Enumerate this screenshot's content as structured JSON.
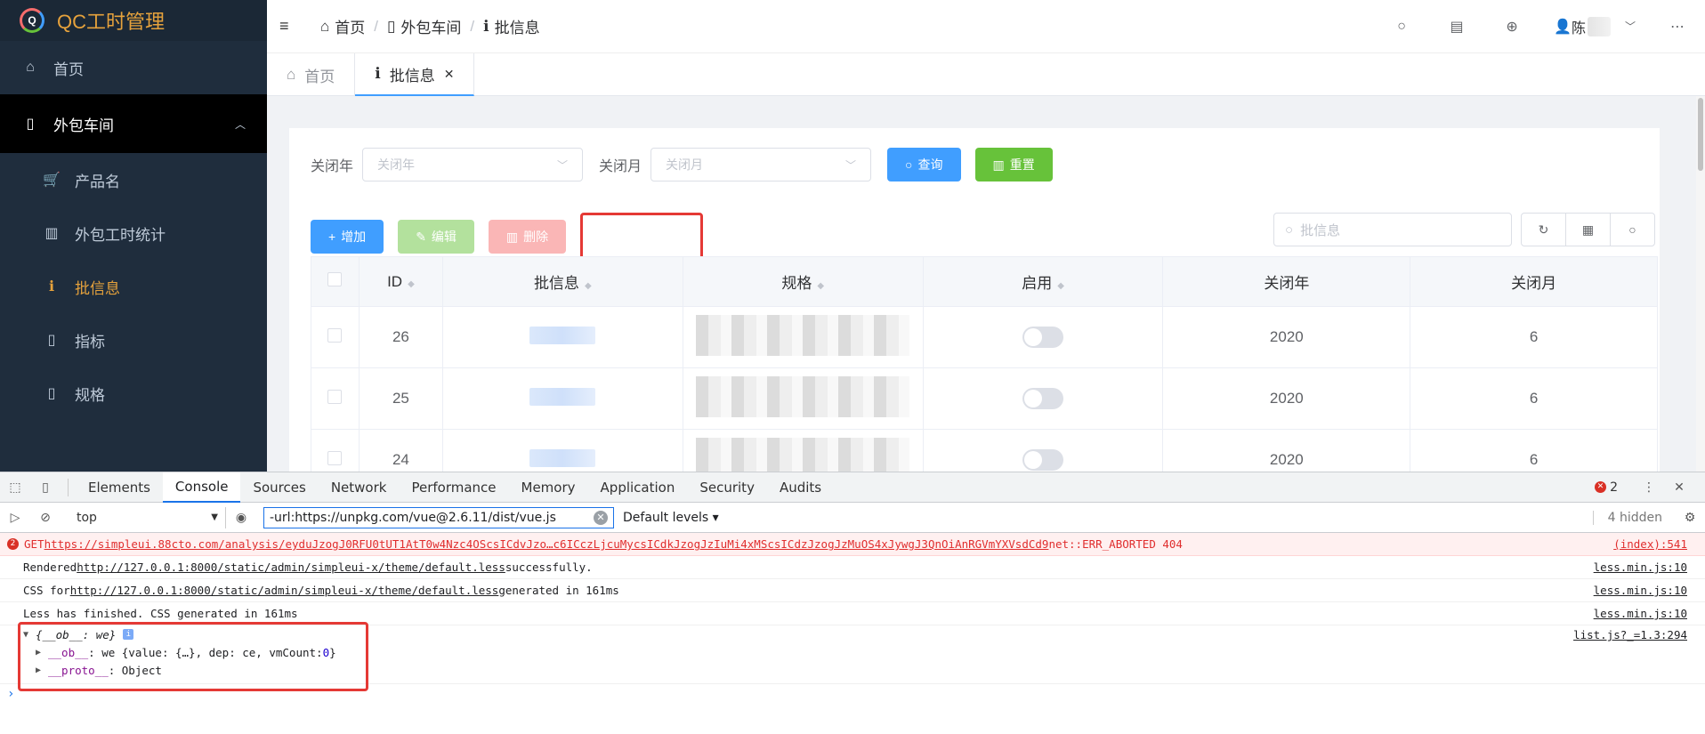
{
  "app": {
    "title": "QC工时管理",
    "logo_letter": "Q"
  },
  "sidebar": {
    "home": "首页",
    "group": "外包车间",
    "items": [
      {
        "label": "产品名",
        "icon": "cart-icon"
      },
      {
        "label": "外包工时统计",
        "icon": "bar-chart-icon"
      },
      {
        "label": "批信息",
        "icon": "info-icon"
      },
      {
        "label": "指标",
        "icon": "file-icon"
      },
      {
        "label": "规格",
        "icon": "file-icon"
      }
    ]
  },
  "breadcrumb": [
    "首页",
    "外包车间",
    "批信息"
  ],
  "user": {
    "name": "陈"
  },
  "tabs": [
    {
      "label": "首页"
    },
    {
      "label": "批信息"
    }
  ],
  "filters": {
    "year_label": "关闭年",
    "year_placeholder": "关闭年",
    "month_label": "关闭月",
    "month_placeholder": "关闭月",
    "query": "查询",
    "reset": "重置"
  },
  "actions": {
    "add": "增加",
    "edit": "编辑",
    "delete": "删除"
  },
  "search": {
    "placeholder": "批信息"
  },
  "table": {
    "columns": [
      "ID",
      "批信息",
      "规格",
      "启用",
      "关闭年",
      "关闭月"
    ],
    "rows": [
      {
        "id": "26",
        "year": "2020",
        "month": "6"
      },
      {
        "id": "25",
        "year": "2020",
        "month": "6"
      },
      {
        "id": "24",
        "year": "2020",
        "month": "6"
      }
    ]
  },
  "devtools": {
    "tabs": [
      "Elements",
      "Console",
      "Sources",
      "Network",
      "Performance",
      "Memory",
      "Application",
      "Security",
      "Audits"
    ],
    "error_count": "2",
    "context": "top",
    "filter": "-url:https://unpkg.com/vue@2.6.11/dist/vue.js",
    "levels": "Default levels ▾",
    "hidden": "4 hidden",
    "logs": [
      {
        "text_pre": "GET ",
        "link": "https://simpleui.88cto.com/analysis/eyduJzogJ0RFU0tUT1AtT0w4Nzc4OScsICdvJzo…c6ICczLjcuMycsICdkJzogJzIuMi4xMScsICdzJzogJzMuOS4xJywgJ3QnOiAnRGVmYXVsdCd9",
        "text_post": " net::ERR_ABORTED 404",
        "src": "(index):541"
      },
      {
        "text_pre": "Rendered ",
        "link": "http://127.0.0.1:8000/static/admin/simpleui-x/theme/default.less",
        "text_post": " successfully.",
        "src": "less.min.js:10"
      },
      {
        "text_pre": "CSS for ",
        "link": "http://127.0.0.1:8000/static/admin/simpleui-x/theme/default.less",
        "text_post": " generated in 161ms",
        "src": "less.min.js:10"
      },
      {
        "text_pre": "Less has finished. CSS generated in 161ms",
        "link": "",
        "text_post": "",
        "src": "less.min.js:10"
      }
    ],
    "object": {
      "summary": "{__ob__: we}",
      "ob_key": "__ob__",
      "ob_val": ": we {value: {…}, dep: ce, vmCount: ",
      "ob_count": "0",
      "ob_close": "}",
      "proto_key": "__proto__",
      "proto_val": ": Object",
      "src": "list.js?_=1.3:294"
    }
  }
}
